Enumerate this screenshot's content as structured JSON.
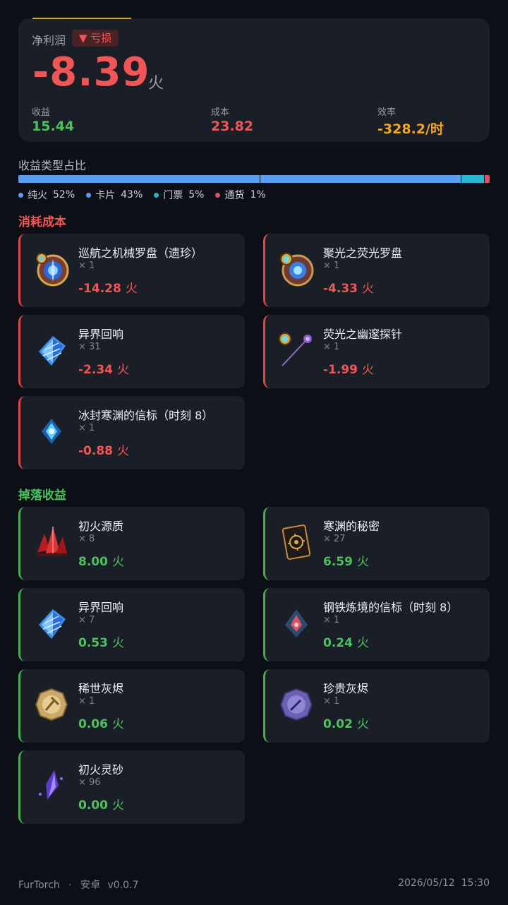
{
  "summary": {
    "net_label": "净利润",
    "badge": "▼ 亏损",
    "net_value": "-8.39",
    "unit": "火",
    "income_label": "收益",
    "income_value": "15.44",
    "cost_label": "成本",
    "cost_value": "23.82",
    "efficiency_label": "效率",
    "efficiency_value": "-328.2/时"
  },
  "ratio": {
    "title": "收益类型占比",
    "segments": [
      {
        "label": "纯火",
        "pct": "52%",
        "value": 52,
        "color": "#5a9ef0"
      },
      {
        "label": "卡片",
        "pct": "43%",
        "value": 43,
        "color": "#5a9ef0"
      },
      {
        "label": "门票",
        "pct": "5%",
        "value": 5,
        "color": "#27b7d0"
      },
      {
        "label": "通货",
        "pct": "1%",
        "value": 1,
        "color": "#e0506a"
      }
    ]
  },
  "cost_section": {
    "title": "消耗成本",
    "items": [
      {
        "name": "巡航之机械罗盘（遗珍）",
        "qty": "× 1",
        "value": "-14.28",
        "unit": "火",
        "icon": "compass-relic-icon"
      },
      {
        "name": "聚光之荧光罗盘",
        "qty": "× 1",
        "value": "-4.33",
        "unit": "火",
        "icon": "fluorescent-compass-icon"
      },
      {
        "name": "异界回响",
        "qty": "× 31",
        "value": "-2.34",
        "unit": "火",
        "icon": "blue-crystal-icon"
      },
      {
        "name": "荧光之幽邃探针",
        "qty": "× 1",
        "value": "-1.99",
        "unit": "火",
        "icon": "probe-wand-icon"
      },
      {
        "name": "冰封寒渊的信标（时刻 8）",
        "qty": "× 1",
        "value": "-0.88",
        "unit": "火",
        "icon": "ice-beacon-icon"
      }
    ]
  },
  "gain_section": {
    "title": "掉落收益",
    "items": [
      {
        "name": "初火源质",
        "qty": "× 8",
        "value": "8.00",
        "unit": "火",
        "icon": "red-crystal-icon"
      },
      {
        "name": "寒渊的秘密",
        "qty": "× 27",
        "value": "6.59",
        "unit": "火",
        "icon": "secret-card-icon"
      },
      {
        "name": "异界回响",
        "qty": "× 7",
        "value": "0.53",
        "unit": "火",
        "icon": "blue-crystal-icon"
      },
      {
        "name": "钢铁炼境的信标（时刻 8）",
        "qty": "× 1",
        "value": "0.24",
        "unit": "火",
        "icon": "steel-beacon-icon"
      },
      {
        "name": "稀世灰烬",
        "qty": "× 1",
        "value": "0.06",
        "unit": "火",
        "icon": "gold-ash-coin-icon"
      },
      {
        "name": "珍贵灰烬",
        "qty": "× 1",
        "value": "0.02",
        "unit": "火",
        "icon": "purple-ash-coin-icon"
      },
      {
        "name": "初火灵砂",
        "qty": "× 96",
        "value": "0.00",
        "unit": "火",
        "icon": "purple-shard-icon"
      }
    ]
  },
  "footer": {
    "app": "FurTorch",
    "sep": "·",
    "platform": "安卓",
    "version": "v0.0.7",
    "datetime": "2026/05/12  15:30"
  },
  "colors": {
    "loss": "#f05656",
    "gain": "#4cc25e",
    "efficiency": "#f3a51b",
    "card_bg": "#1a1e26",
    "page_bg": "#0c0f15"
  }
}
